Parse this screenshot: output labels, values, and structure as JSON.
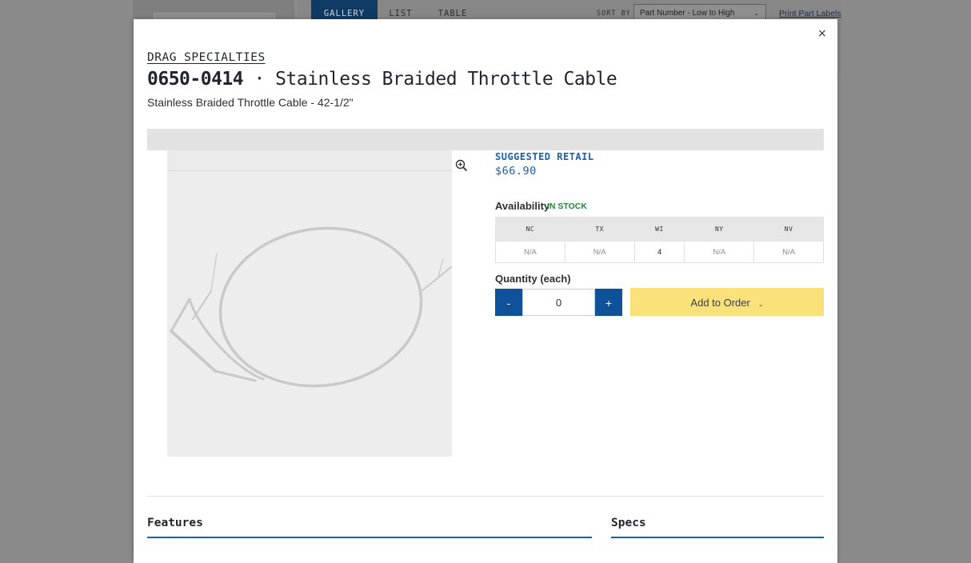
{
  "background": {
    "tabs": [
      {
        "label": "GALLERY"
      },
      {
        "label": "LIST"
      },
      {
        "label": "TABLE"
      }
    ],
    "sort_label": "SORT BY",
    "sort_value": "Part Number - Low to High",
    "print_link": "Print Part Labels"
  },
  "modal": {
    "close_glyph": "×",
    "brand": "DRAG SPECIALTIES",
    "part_number": "0650-0414",
    "separator": " · ",
    "product_name": "Stainless Braided Throttle Cable",
    "subtitle": "Stainless Braided Throttle Cable - 42-1/2\"",
    "image_icon": "zoom-in-icon",
    "retail_label": "SUGGESTED RETAIL",
    "retail_price": "$66.90",
    "availability_label": "Availability",
    "availability_status": "IN STOCK",
    "warehouses": [
      {
        "code": "NC",
        "qty": "N/A"
      },
      {
        "code": "TX",
        "qty": "N/A"
      },
      {
        "code": "WI",
        "qty": "4"
      },
      {
        "code": "NY",
        "qty": "N/A"
      },
      {
        "code": "NV",
        "qty": "N/A"
      }
    ],
    "quantity_label": "Quantity (each)",
    "minus_label": "-",
    "plus_label": "+",
    "quantity_value": "0",
    "add_label": "Add to Order",
    "add_icon": "chevron-down-icon",
    "features_label": "Features",
    "specs_label": "Specs"
  },
  "colors": {
    "accent_blue": "#0f5299",
    "retail_blue": "#1d5fa8",
    "stock_green": "#1f8a3a",
    "add_yellow": "#f9e27a"
  }
}
